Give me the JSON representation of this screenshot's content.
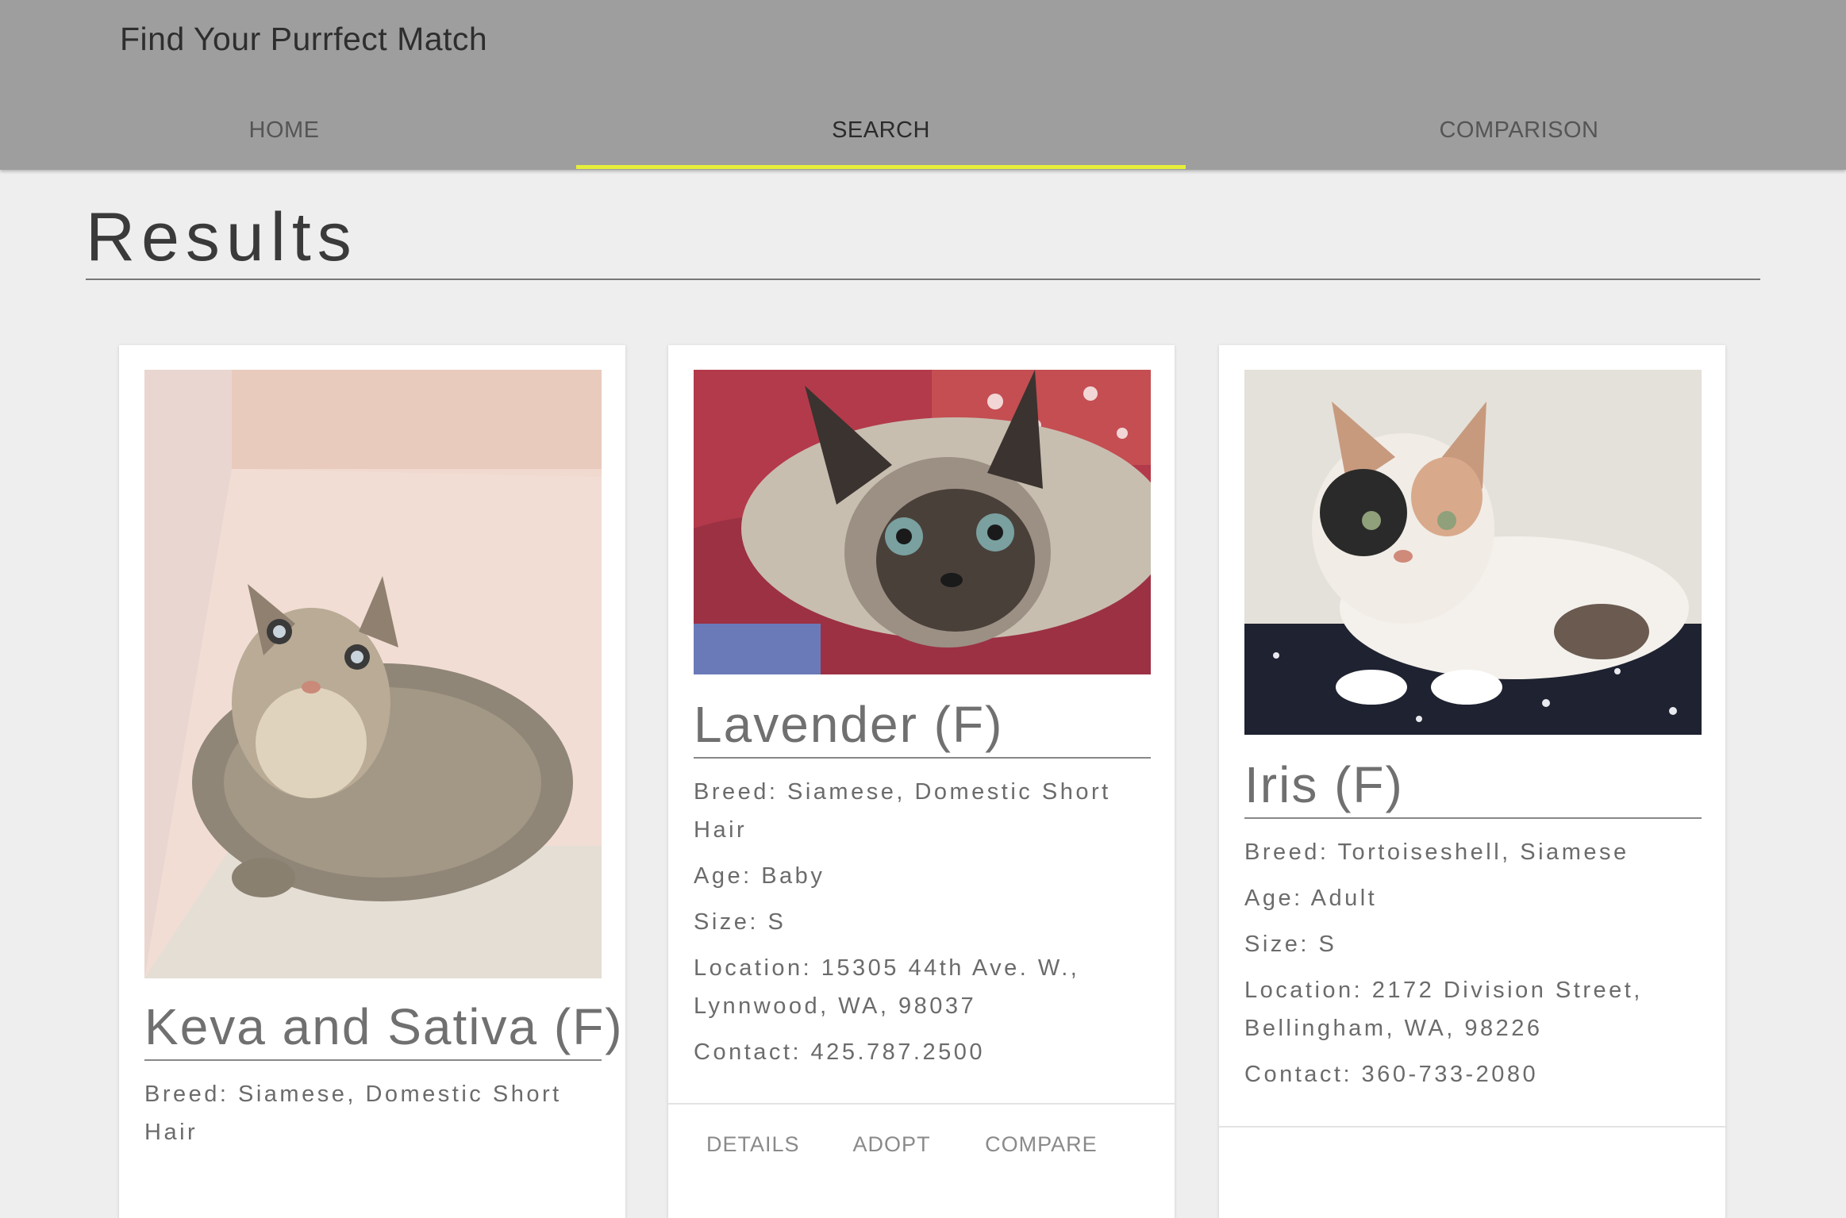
{
  "app": {
    "title": "Find Your Purrfect Match"
  },
  "tabs": [
    {
      "label": "HOME"
    },
    {
      "label": "SEARCH",
      "active": true
    },
    {
      "label": "COMPARISON"
    }
  ],
  "results": {
    "heading": "Results"
  },
  "cards": [
    {
      "name": "Keva and Sativa (F)",
      "breed": "Breed: Siamese, Domestic Short Hair",
      "age": "",
      "size": "",
      "location": "",
      "contact": "",
      "actions": []
    },
    {
      "name": "Lavender (F)",
      "breed": "Breed: Siamese, Domestic Short Hair",
      "age": "Age: Baby",
      "size": "Size: S",
      "location": "Location: 15305 44th Ave. W., Lynnwood, WA, 98037",
      "contact": "Contact: 425.787.2500",
      "actions": [
        "DETAILS",
        "ADOPT",
        "COMPARE"
      ]
    },
    {
      "name": "Iris (F)",
      "breed": "Breed: Tortoiseshell, Siamese",
      "age": "Age: Adult",
      "size": "Size: S",
      "location": "Location: 2172 Division Street, Bellingham, WA, 98226",
      "contact": "Contact: 360-733-2080",
      "actions": []
    }
  ],
  "colors": {
    "appbar": "#9e9e9e",
    "tab_indicator": "#e6ee3a",
    "background": "#eeeeee"
  }
}
